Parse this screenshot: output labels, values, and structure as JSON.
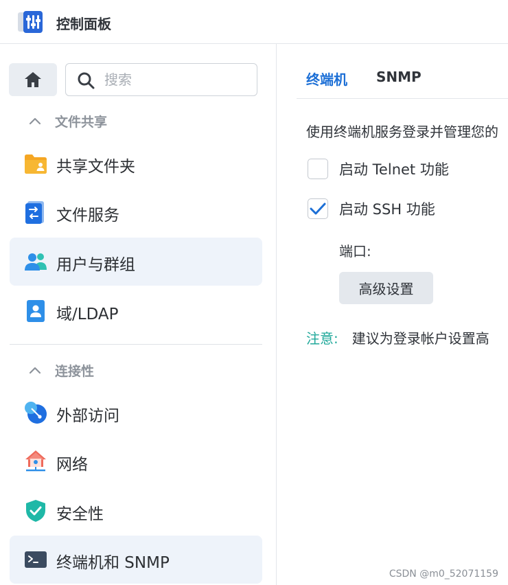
{
  "app": {
    "title": "控制面板",
    "icon": "control-panel-icon"
  },
  "sidebar": {
    "home_icon": "home-icon",
    "search": {
      "placeholder": "搜索",
      "value": ""
    },
    "groups": [
      {
        "label": "文件共享",
        "expanded": true,
        "items": [
          {
            "label": "共享文件夹",
            "icon": "shared-folder-icon",
            "selected": false
          },
          {
            "label": "文件服务",
            "icon": "file-services-icon",
            "selected": false
          },
          {
            "label": "用户与群组",
            "icon": "user-group-icon",
            "selected": false
          },
          {
            "label": "域/LDAP",
            "icon": "domain-ldap-icon",
            "selected": false
          }
        ]
      },
      {
        "label": "连接性",
        "expanded": true,
        "items": [
          {
            "label": "外部访问",
            "icon": "external-access-icon",
            "selected": false
          },
          {
            "label": "网络",
            "icon": "network-icon",
            "selected": false
          },
          {
            "label": "安全性",
            "icon": "security-shield-icon",
            "selected": false
          },
          {
            "label": "终端机和 SNMP",
            "icon": "terminal-icon",
            "selected": true
          }
        ]
      }
    ]
  },
  "main": {
    "tabs": [
      {
        "label": "终端机",
        "active": true
      },
      {
        "label": "SNMP",
        "active": false
      }
    ],
    "description": "使用终端机服务登录并管理您的",
    "options": [
      {
        "label": "启动 Telnet 功能",
        "checked": false
      },
      {
        "label": "启动 SSH 功能",
        "checked": true
      }
    ],
    "port_label": "端口:",
    "advanced_button": "高级设置",
    "note": {
      "label": "注意:",
      "text": "建议为登录帐户设置高"
    }
  },
  "watermark": "CSDN @m0_52071159",
  "colors": {
    "accent_blue": "#1c6fd6",
    "note_teal": "#1fa89a",
    "selected_bg": "#eef3fa"
  }
}
